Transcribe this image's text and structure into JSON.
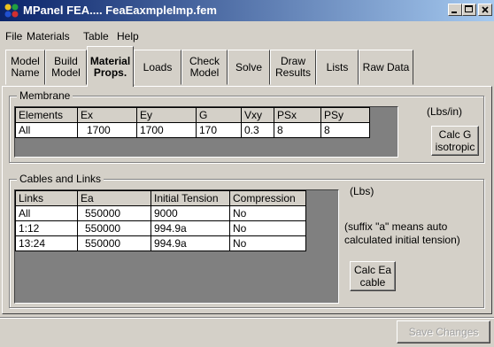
{
  "window": {
    "title": "MPanel FEA.... FeaEaxmpleImp.fem",
    "minimize_label": "Minimize",
    "maximize_label": "Maximize",
    "close_label": "Close"
  },
  "menu": [
    "File",
    "Materials",
    "Table",
    "Help"
  ],
  "tabs": [
    {
      "label": "Model\nName"
    },
    {
      "label": "Build\nModel"
    },
    {
      "label": "Material\nProps."
    },
    {
      "label": "Loads"
    },
    {
      "label": "Check\nModel"
    },
    {
      "label": "Solve"
    },
    {
      "label": "Draw\nResults"
    },
    {
      "label": "Lists"
    },
    {
      "label": "Raw Data"
    }
  ],
  "active_tab": "Material\nProps.",
  "membrane": {
    "group_label": "Membrane",
    "units": "(Lbs/in)",
    "columns": [
      "Elements",
      "Ex",
      "Ey",
      "G",
      "Vxy",
      "PSx",
      "PSy"
    ],
    "rows": [
      [
        "All",
        "1700",
        "1700",
        "170",
        "0.3",
        "8",
        "8"
      ]
    ],
    "calc_button": "Calc G\nisotropic"
  },
  "cables": {
    "group_label": "Cables and Links",
    "units": "(Lbs)",
    "note": "(suffix \"a\" means auto\ncalculated initial tension)",
    "columns": [
      "Links",
      "Ea",
      "Initial Tension",
      "Compression"
    ],
    "rows": [
      [
        "All",
        "550000",
        "9000",
        "No"
      ],
      [
        "1:12",
        "550000",
        "994.9a",
        "No"
      ],
      [
        "13:24",
        "550000",
        "994.9a",
        "No"
      ]
    ],
    "calc_button": "Calc Ea\ncable"
  },
  "save_button": "Save Changes",
  "colors": {
    "title_start": "#0a246a",
    "title_end": "#a6caf0",
    "face": "#d4d0c8"
  }
}
